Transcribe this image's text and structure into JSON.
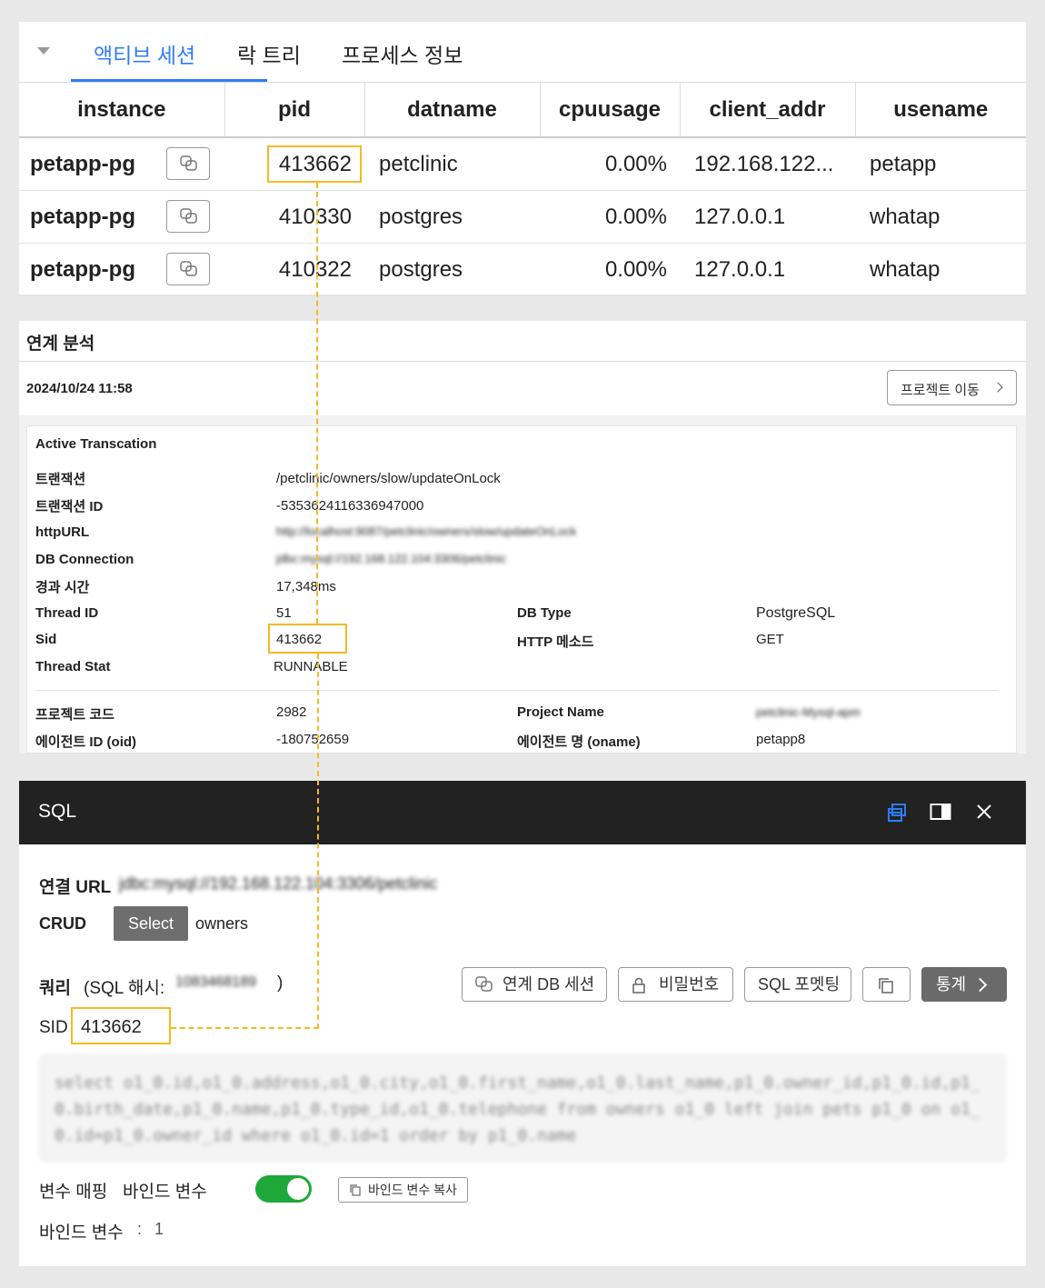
{
  "tabs": {
    "active": "액티브 세션",
    "lock_tree": "락 트리",
    "process_info": "프로세스 정보"
  },
  "table": {
    "columns": [
      "instance",
      "pid",
      "datname",
      "cpuusage",
      "client_addr",
      "usename"
    ],
    "rows": [
      {
        "instance": "petapp-pg",
        "pid": "413662",
        "datname": "petclinic",
        "cpuusage": "0.00%",
        "client_addr": "192.168.122...",
        "usename": "petapp"
      },
      {
        "instance": "petapp-pg",
        "pid": "410330",
        "datname": "postgres",
        "cpuusage": "0.00%",
        "client_addr": "127.0.0.1",
        "usename": "whatap"
      },
      {
        "instance": "petapp-pg",
        "pid": "410322",
        "datname": "postgres",
        "cpuusage": "0.00%",
        "client_addr": "127.0.0.1",
        "usename": "whatap"
      }
    ]
  },
  "analysis": {
    "title": "연계 분석",
    "datetime": "2024/10/24 11:58",
    "project_button": "프로젝트 이동",
    "card_title": "Active Transcation",
    "fields": {
      "transaction": {
        "label": "트랜잭션",
        "value": "/petclinic/owners/slow/updateOnLock"
      },
      "transaction_id": {
        "label": "트랜잭션 ID",
        "value": "-5353624116336947000"
      },
      "http_url": {
        "label": "httpURL",
        "value": "http://localhost:9087/petclinic/owners/slow/updateOnLock"
      },
      "db_connection": {
        "label": "DB Connection",
        "value": "jdbc:mysql://192.168.122.104:3306/petclinic"
      },
      "elapsed": {
        "label": "경과 시간",
        "value": "17,348ms"
      },
      "thread_id": {
        "label": "Thread ID",
        "value": "51"
      },
      "db_type": {
        "label": "DB Type",
        "value": "PostgreSQL"
      },
      "sid": {
        "label": "Sid",
        "value": "413662"
      },
      "http_method": {
        "label": "HTTP 메소드",
        "value": "GET"
      },
      "thread_stat": {
        "label": "Thread Stat",
        "value": "RUNNABLE"
      },
      "project_code": {
        "label": "프로젝트 코드",
        "value": "2982"
      },
      "project_name": {
        "label": "Project Name",
        "value": "petclinic-Mysql-apm"
      },
      "agent_id": {
        "label": "에이전트 ID (oid)",
        "value": "-180752659"
      },
      "agent_name": {
        "label": "에이전트 명 (oname)",
        "value": "petapp8"
      }
    }
  },
  "sql": {
    "title": "SQL",
    "conn_url_label": "연결 URL",
    "conn_url_value": "jdbc:mysql://192.168.122.104:3306/petclinic",
    "crud_label": "CRUD",
    "crud_badge": "Select",
    "crud_table": "owners",
    "query_label": "쿼리",
    "hash_prefix": "(SQL 해시:",
    "hash_value": "1083468189",
    "hash_suffix": ")",
    "buttons": {
      "linked_db_session": "연계 DB 세션",
      "password": "비밀번호",
      "sql_format": "SQL 포멧팅",
      "stats": "통계"
    },
    "sid_label": "SID",
    "sid_value": "413662",
    "query_text": "select o1_0.id,o1_0.address,o1_0.city,o1_0.first_name,o1_0.last_name,p1_0.owner_id,p1_0.id,p1_0.birth_date,p1_0.name,p1_0.type_id,o1_0.telephone from owners o1_0 left join pets p1_0 on o1_0.id=p1_0.owner_id where o1_0.id=1 order by p1_0.name",
    "var_mapping_label": "변수 매핑",
    "bind_var_label": "바인드 변수",
    "bind_copy_button": "바인드 변수 복사",
    "bind_vars_label": "바인드 변수",
    "bind_vars_sep": ":",
    "bind_vars_value": "1"
  },
  "colors": {
    "accent": "#2f7cf6",
    "highlight": "#f5b923",
    "toggle_on": "#1fa83a",
    "header_dark": "#222222"
  }
}
